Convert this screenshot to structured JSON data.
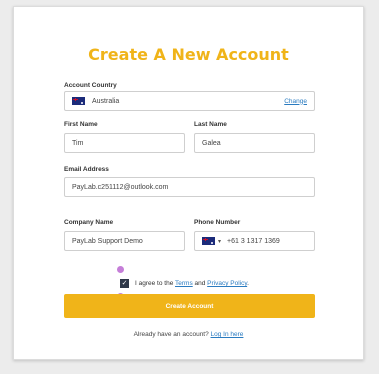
{
  "title": "Create A New Account",
  "account_country": {
    "label": "Account Country",
    "value": "Australia",
    "flag_icon": "australia-flag-icon",
    "change_label": "Change"
  },
  "first_name": {
    "label": "First Name",
    "value": "Tim"
  },
  "last_name": {
    "label": "Last Name",
    "value": "Galea"
  },
  "email": {
    "label": "Email Address",
    "value": "PayLab.c251112@outlook.com"
  },
  "company": {
    "label": "Company Name",
    "value": "PayLab Support Demo"
  },
  "phone": {
    "label": "Phone Number",
    "flag_icon": "australia-flag-icon",
    "caret": "▾",
    "value": "+61 3 1317 1369"
  },
  "agree": {
    "prefix": "I agree to the ",
    "terms": "Terms",
    "and": " and ",
    "privacy": "Privacy Policy",
    "suffix": ".",
    "checked": true
  },
  "create_button": "Create Account",
  "signin": {
    "prefix": "Already have an account? ",
    "link": "Log In here"
  },
  "colors": {
    "accent": "#f0b419",
    "link": "#2a7bc0",
    "marker": "#c57ed8"
  }
}
